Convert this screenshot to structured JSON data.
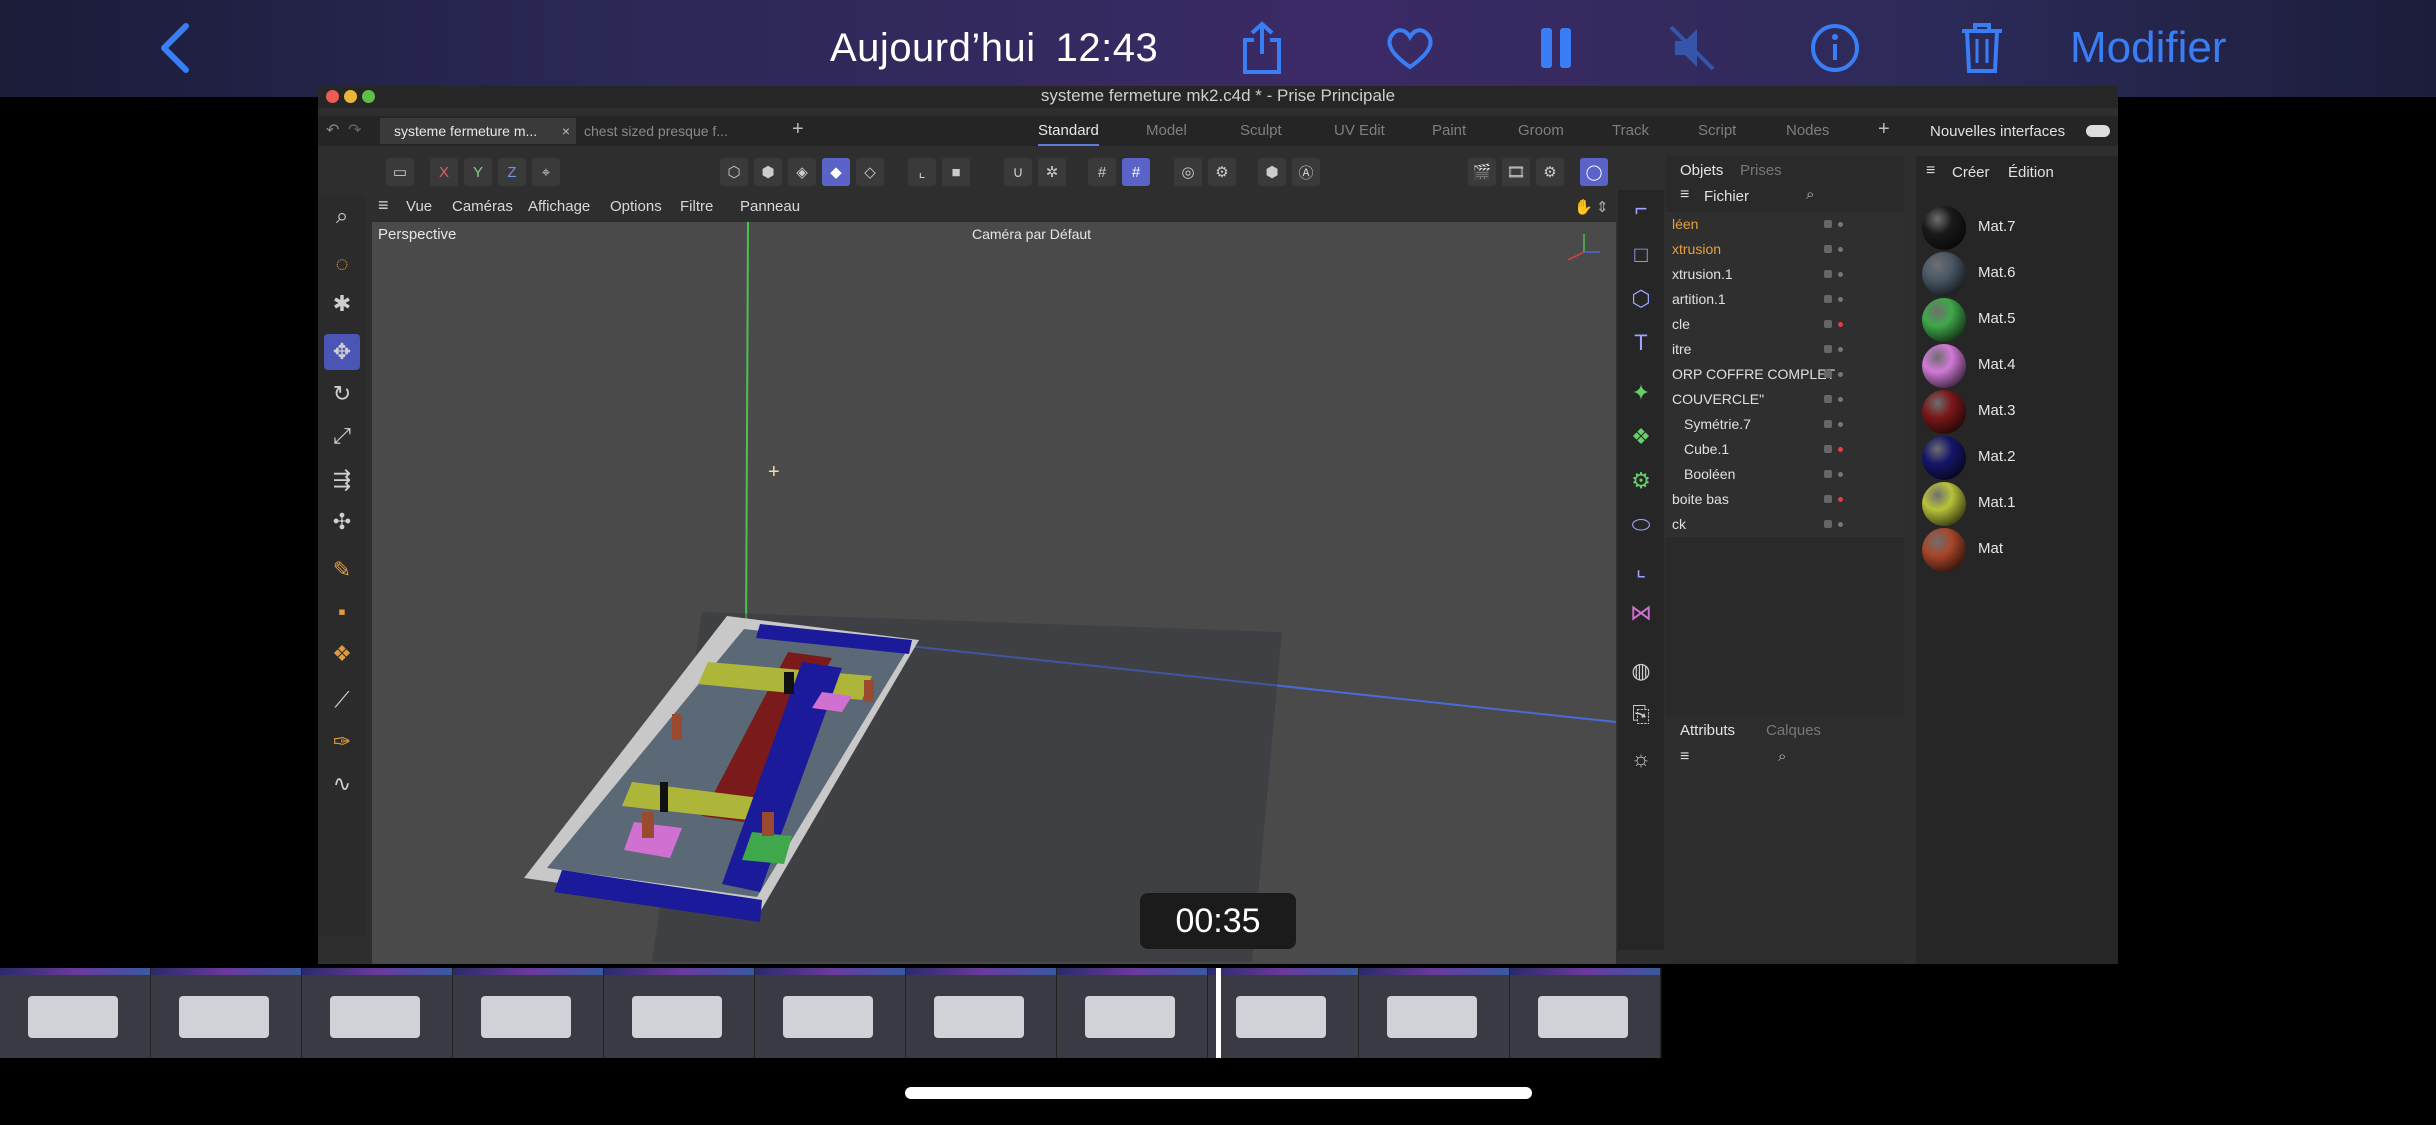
{
  "photos_bar": {
    "date_label": "Aujourd’hui",
    "time_label": "12:43",
    "edit_label": "Modifier",
    "icons": [
      "chevron-left-icon",
      "share-icon",
      "heart-icon",
      "pause-icon",
      "mute-icon",
      "info-icon",
      "trash-icon"
    ]
  },
  "video": {
    "timestamp": "00:35"
  },
  "c4d": {
    "window_title": "systeme fermeture mk2.c4d * - Prise Principale",
    "doc_tabs": [
      "systeme fermeture m...",
      "chest sized presque f..."
    ],
    "workspaces": [
      "Standard",
      "Model",
      "Sculpt",
      "UV Edit",
      "Paint",
      "Groom",
      "Track",
      "Script",
      "Nodes"
    ],
    "active_workspace": "Standard",
    "new_interfaces_label": "Nouvelles interfaces",
    "axis_labels": [
      "X",
      "Y",
      "Z"
    ],
    "viewport_menu": [
      "Vue",
      "Caméras",
      "Affichage",
      "Options",
      "Filtre",
      "Panneau"
    ],
    "viewport_label": "Perspective",
    "camera_label": "Caméra par Défaut",
    "objects_tabs": [
      "Objets",
      "Prises"
    ],
    "objects_menu": "Fichier",
    "objects": [
      "léen",
      "xtrusion",
      "xtrusion.1",
      "artition.1",
      "cle",
      "itre",
      "ORP COFFRE COMPLET",
      "COUVERCLE\"",
      "Symétrie.7",
      "Cube.1",
      "Booléen",
      "boite bas",
      "ck"
    ],
    "attributes_tabs": [
      "Attributs",
      "Calques"
    ],
    "materials_menu": [
      "Créer",
      "Édition"
    ],
    "materials": [
      {
        "name": "Mat.7",
        "color": "#1a1a1a"
      },
      {
        "name": "Mat.6",
        "color": "#4a5866"
      },
      {
        "name": "Mat.5",
        "color": "#3fa84a"
      },
      {
        "name": "Mat.4",
        "color": "#d07ad6"
      },
      {
        "name": "Mat.3",
        "color": "#7a1818"
      },
      {
        "name": "Mat.2",
        "color": "#16166a"
      },
      {
        "name": "Mat.1",
        "color": "#b8c23a"
      },
      {
        "name": "Mat",
        "color": "#a8462a"
      }
    ]
  },
  "colors": {
    "accent": "#3a7ef5",
    "c4d_selected": "#5a63c8"
  }
}
